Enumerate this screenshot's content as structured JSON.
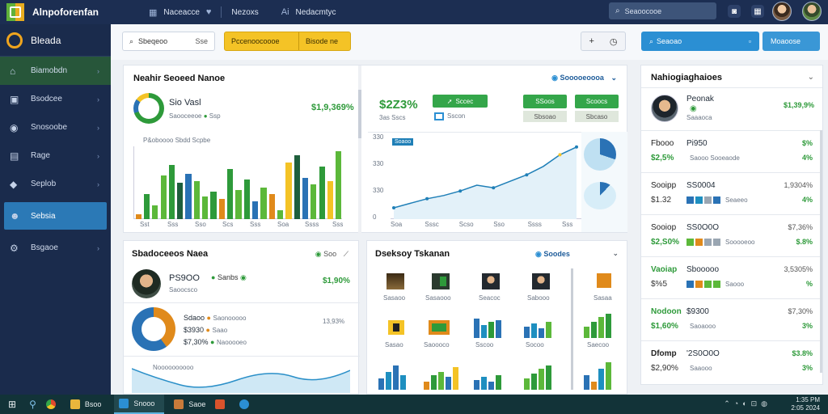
{
  "topbar": {
    "app_title": "Alnpoforenfan",
    "nav": [
      {
        "icon": "grid-icon",
        "glyph": "▦",
        "label": "Naceacce"
      },
      {
        "icon": "heart-icon",
        "glyph": "♥",
        "label": "Nezoxs"
      },
      {
        "icon": "ai-icon",
        "glyph": "Ai",
        "label": "Nedacmtyc"
      }
    ],
    "search_text": "Seaoocooe"
  },
  "sidebar": {
    "brand": "Bleada",
    "items": [
      {
        "label": "Biamobdn",
        "icon": "home-icon",
        "glyph": "⌂"
      },
      {
        "label": "Bsodcee",
        "icon": "folder-icon",
        "glyph": "▣"
      },
      {
        "label": "Snosoobe",
        "icon": "eye-icon",
        "glyph": "◉"
      },
      {
        "label": "Rage",
        "icon": "doc-icon",
        "glyph": "▤"
      },
      {
        "label": "Seplob",
        "icon": "shield-icon",
        "glyph": "◆"
      },
      {
        "label": "Sebsia",
        "icon": "users-icon",
        "glyph": "☻"
      },
      {
        "label": "Bsgaoe",
        "icon": "settings-icon",
        "glyph": "⚙"
      }
    ]
  },
  "toolbar": {
    "search_text": "Sbeqeoo",
    "search_right": "Sse",
    "yellow_left": "Pccenoocoooe",
    "yellow_right": "Bisode ne",
    "blue_left": "Seaoao",
    "blue_right": "Moaoose"
  },
  "panel_main": {
    "title": "Neahir Seoeed Nanoe",
    "header_right": "Sooooeoooa",
    "stat_title": "Sio Vasl",
    "stat_sub": "Saooceeoe",
    "stat_sub2": "Ssp",
    "stat_value": "$1,9,369%",
    "bars_caption": "P&oboooo Sbdd Scpbe",
    "bars_xlabels": [
      "Sst",
      "Sss",
      "Sso",
      "Scs",
      "Sss",
      "Soa",
      "Ssss",
      "Sss"
    ],
    "bars": [
      {
        "v": 5,
        "c": "#e08a1b"
      },
      {
        "v": 28,
        "c": "#2e9a3a"
      },
      {
        "v": 15,
        "c": "#5cb83a"
      },
      {
        "v": 48,
        "c": "#5cb83a"
      },
      {
        "v": 60,
        "c": "#2e9a3a"
      },
      {
        "v": 40,
        "c": "#1e5f3c"
      },
      {
        "v": 50,
        "c": "#2a72b5"
      },
      {
        "v": 42,
        "c": "#5cb83a"
      },
      {
        "v": 25,
        "c": "#5cb83a"
      },
      {
        "v": 30,
        "c": "#2e9a3a"
      },
      {
        "v": 22,
        "c": "#e08a1b"
      },
      {
        "v": 55,
        "c": "#2e9a3a"
      },
      {
        "v": 32,
        "c": "#5cb83a"
      },
      {
        "v": 44,
        "c": "#2e9a3a"
      },
      {
        "v": 20,
        "c": "#2a72b5"
      },
      {
        "v": 35,
        "c": "#5cb83a"
      },
      {
        "v": 28,
        "c": "#e08a1b"
      },
      {
        "v": 10,
        "c": "#5cb83a"
      },
      {
        "v": 62,
        "c": "#f4c326"
      },
      {
        "v": 70,
        "c": "#1e5f3c"
      },
      {
        "v": 45,
        "c": "#2a72b5"
      },
      {
        "v": 38,
        "c": "#5cb83a"
      },
      {
        "v": 58,
        "c": "#2e9a3a"
      },
      {
        "v": 42,
        "c": "#f4c326"
      },
      {
        "v": 75,
        "c": "#5cb83a"
      }
    ],
    "line_value": "$2Z3%",
    "line_badge": "Sccec",
    "line_sub": "3as Sscs",
    "line_sub2": "Sscon",
    "badge_a": "SSoos",
    "badge_a2": "Sbsoao",
    "badge_b": "Scoocs",
    "badge_b2": "Sbcaso",
    "line_tag": "Soaoo",
    "line_yticks": [
      "330",
      "330",
      "330",
      "0"
    ],
    "line_xlabels": [
      "Soa",
      "Sssc",
      "Scso",
      "Sso",
      "Ssss",
      "Sss"
    ],
    "line_points": [
      0,
      14,
      28,
      38,
      52,
      70,
      62,
      82,
      102,
      128,
      164,
      188
    ]
  },
  "panel_left2": {
    "title": "Sbadoceeos Naea",
    "header_right": "Soo",
    "name": "PS9OO",
    "name_sub": "Saoocsco",
    "badge": "Sanbs",
    "value": "$1,90%",
    "donut_r1": "Sdaoo",
    "donut_r1b": "Saonooooo",
    "donut_r2": "$3930",
    "donut_r2b": "Saao",
    "donut_r3": "$7,30%",
    "donut_r3b": "Naooooeo",
    "donut_right": "13,93%",
    "area_title": "Noooooooooo"
  },
  "panel_tiles": {
    "title": "Dseksoy Tskanan",
    "header_right": "Soodes",
    "labels": [
      "Sasaoo",
      "Sasaooo",
      "Seacoc",
      "Sabooo",
      "Sasaa",
      "Sasao",
      "Saoooco",
      "Sscoo",
      "Socoo",
      "Saecoo"
    ]
  },
  "panel_right": {
    "title": "Nahiogiaghaioes",
    "profile_name": "Peonak",
    "profile_sub": "Saaaoca",
    "profile_value": "$1,39,9%",
    "rows": [
      {
        "label": "Fbooo",
        "sub": "$2,5%",
        "name": "Pi950",
        "desc": "Saooo Sooeaode",
        "pct": "$%",
        "pct2": "4%"
      },
      {
        "label": "Sooipp",
        "sub": "$1.32",
        "name": "SS0004",
        "desc": "Seaeeo",
        "pct": "1,9304%",
        "pct2": "4%"
      },
      {
        "label": "Sooiop",
        "sub": "$2,S0%",
        "name": "SS0O0O",
        "desc": "Sooooeoo",
        "pct": "$7,36%",
        "pct2": "$.8%"
      },
      {
        "label": "Vaoiap",
        "sub": "$%5",
        "name": "Sbooooo",
        "desc": "Saooo",
        "pct": "3,5305%",
        "pct2": "%"
      },
      {
        "label": "Nodoon",
        "sub": "$1,60%",
        "name": "$9300",
        "desc": "Saoaooo",
        "pct": "$7,30%",
        "pct2": "3%"
      },
      {
        "label": "Dfomp",
        "sub": "$2,90%",
        "name": "'2S0O0O",
        "desc": "Saaooo",
        "pct": "$3.8%",
        "pct2": "3%"
      }
    ]
  },
  "taskbar": {
    "items": [
      "Bsoo",
      "Snooo",
      "Saoe"
    ],
    "time": "1:35 PM",
    "date": "2:05 2024"
  }
}
